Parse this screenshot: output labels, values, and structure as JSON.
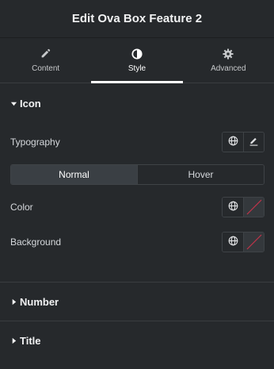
{
  "header": {
    "title": "Edit Ova Box Feature 2"
  },
  "tabs": [
    {
      "label": "Content",
      "icon": "pencil-icon",
      "active": false
    },
    {
      "label": "Style",
      "icon": "contrast-icon",
      "active": true
    },
    {
      "label": "Advanced",
      "icon": "gear-icon",
      "active": false
    }
  ],
  "sections": {
    "icon": {
      "title": "Icon",
      "typography_label": "Typography",
      "state_toggle": {
        "normal": "Normal",
        "hover": "Hover",
        "selected": "Normal"
      },
      "color_label": "Color",
      "background_label": "Background"
    },
    "number": {
      "title": "Number"
    },
    "title": {
      "title": "Title"
    }
  },
  "colors": {
    "panel_bg": "#26292c",
    "active_tab_underline": "#ffffff",
    "empty_swatch_slash": "#c2344a"
  }
}
